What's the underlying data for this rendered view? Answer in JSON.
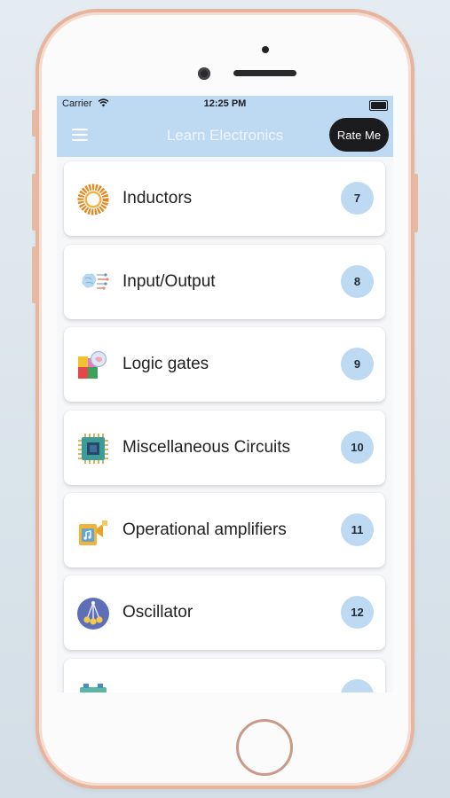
{
  "status_bar": {
    "carrier": "Carrier",
    "time": "12:25 PM"
  },
  "header": {
    "title": "Learn Electronics",
    "rate_label": "Rate Me"
  },
  "colors": {
    "header_bg": "#bed9f2",
    "badge_bg": "#bed9f2",
    "rate_bg": "#1c1c1e",
    "phone_frame": "#e6b49f"
  },
  "topics": [
    {
      "label": "Inductors",
      "count": "7",
      "icon": "inductor-coil-icon"
    },
    {
      "label": "Input/Output",
      "count": "8",
      "icon": "input-output-icon"
    },
    {
      "label": "Logic gates",
      "count": "9",
      "icon": "puzzle-brain-icon"
    },
    {
      "label": "Miscellaneous Circuits",
      "count": "10",
      "icon": "microchip-icon"
    },
    {
      "label": "Operational amplifiers",
      "count": "11",
      "icon": "amplifier-speaker-icon"
    },
    {
      "label": "Oscillator",
      "count": "12",
      "icon": "oscillator-pendulum-icon"
    }
  ]
}
